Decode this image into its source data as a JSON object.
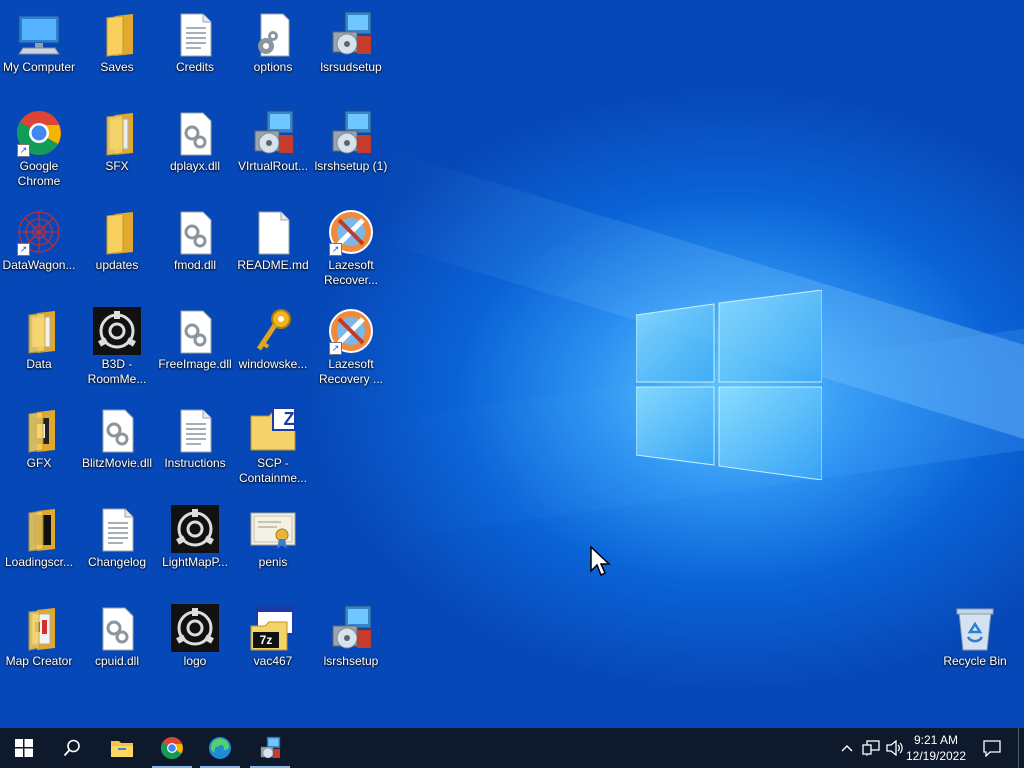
{
  "desktop": {
    "icons": [
      {
        "label": "My Computer"
      },
      {
        "label": "Saves"
      },
      {
        "label": "Credits"
      },
      {
        "label": "options"
      },
      {
        "label": "lsrsudsetup"
      },
      {
        "label": "Google Chrome"
      },
      {
        "label": "SFX"
      },
      {
        "label": "dplayx.dll"
      },
      {
        "label": "VIrtualRout..."
      },
      {
        "label": "lsrshsetup (1)"
      },
      {
        "label": "DataWagon..."
      },
      {
        "label": "updates"
      },
      {
        "label": "fmod.dll"
      },
      {
        "label": "README.md"
      },
      {
        "label": "Lazesoft Recover..."
      },
      {
        "label": "Data"
      },
      {
        "label": "B3D - RoomMe..."
      },
      {
        "label": "FreeImage.dll"
      },
      {
        "label": "windowske..."
      },
      {
        "label": "Lazesoft Recovery ..."
      },
      {
        "label": "GFX"
      },
      {
        "label": "BlitzMovie.dll"
      },
      {
        "label": "Instructions"
      },
      {
        "label": "SCP - Containme..."
      },
      {
        "label": "Loadingscr..."
      },
      {
        "label": "Changelog"
      },
      {
        "label": "LightMapP..."
      },
      {
        "label": "penis"
      },
      {
        "label": "Map Creator"
      },
      {
        "label": "cpuid.dll"
      },
      {
        "label": "logo"
      },
      {
        "label": "vac467"
      },
      {
        "label": "lsrshsetup"
      },
      {
        "label": "Recycle Bin"
      }
    ]
  },
  "taskbar": {
    "clock_time": "9:21 AM",
    "clock_date": "12/19/2022",
    "zip_badge": "Z",
    "sevenzip_badge": "7z"
  },
  "colors": {
    "taskbar": "#0e1a2b",
    "desktop_blue": "#0a63d6",
    "folder_yellow": "#f3c84b"
  }
}
